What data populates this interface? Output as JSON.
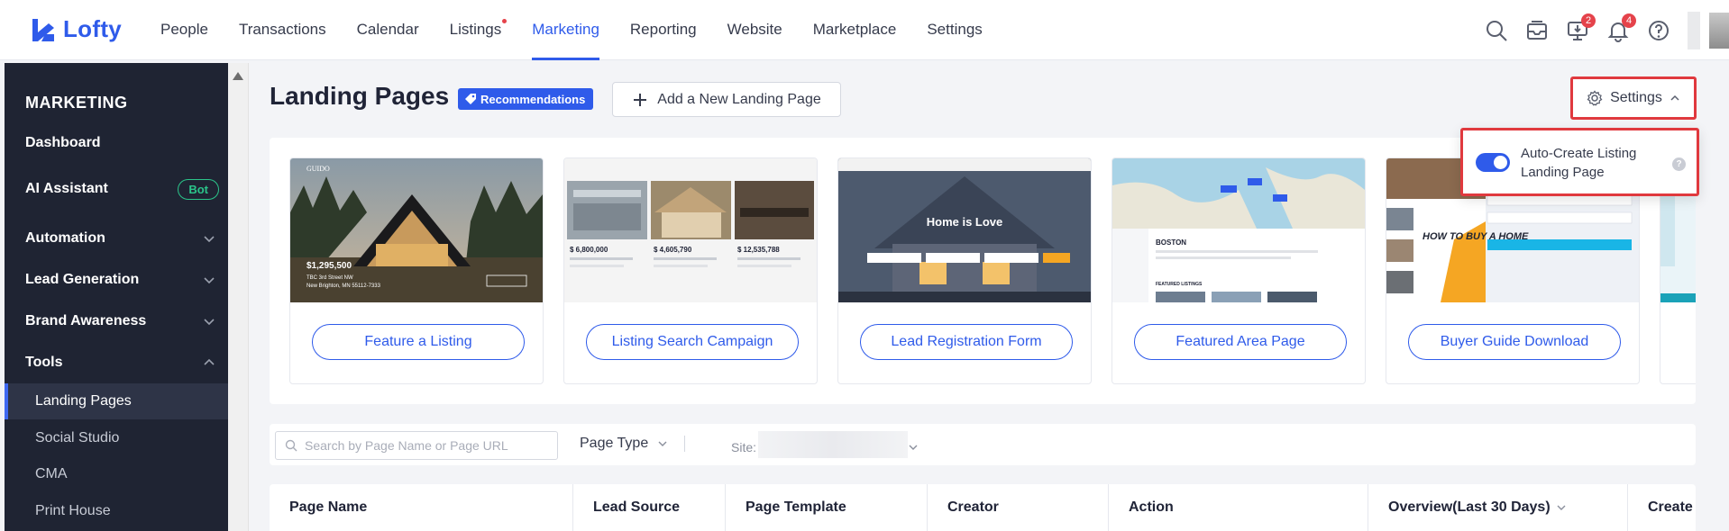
{
  "app": {
    "name": "Lofty",
    "brand_color": "#2f5bea"
  },
  "topnav": {
    "items": [
      {
        "label": "People",
        "active": false
      },
      {
        "label": "Transactions",
        "active": false
      },
      {
        "label": "Calendar",
        "active": false
      },
      {
        "label": "Listings",
        "active": false,
        "dot": true
      },
      {
        "label": "Marketing",
        "active": true
      },
      {
        "label": "Reporting",
        "active": false
      },
      {
        "label": "Website",
        "active": false
      },
      {
        "label": "Marketplace",
        "active": false
      },
      {
        "label": "Settings",
        "active": false
      }
    ],
    "icons": [
      "search-icon",
      "inbox-icon",
      "monitor-icon",
      "bell-icon",
      "help-icon"
    ],
    "monitor_badge": "2",
    "bell_badge": "4"
  },
  "sidebar": {
    "title": "MARKETING",
    "items": [
      {
        "label": "Dashboard"
      },
      {
        "label": "AI Assistant",
        "badge": "Bot"
      },
      {
        "label": "Automation",
        "expanded": false
      },
      {
        "label": "Lead Generation",
        "expanded": false
      },
      {
        "label": "Brand Awareness",
        "expanded": false
      },
      {
        "label": "Tools",
        "expanded": true
      }
    ],
    "sub_items": [
      {
        "label": "Landing Pages",
        "active": true
      },
      {
        "label": "Social Studio",
        "active": false
      },
      {
        "label": "CMA",
        "active": false
      },
      {
        "label": "Print House",
        "active": false
      }
    ]
  },
  "header": {
    "title": "Landing Pages",
    "recommendations_label": "Recommendations",
    "add_label": "Add a New Landing Page",
    "settings_label": "Settings"
  },
  "settings_menu": {
    "toggle_label": "Auto-Create Listing Landing Page",
    "toggle_on": true,
    "help_glyph": "?"
  },
  "templates": [
    {
      "button": "Feature a Listing",
      "price": "$1,295,500",
      "address1": "TBC 3rd Street NW",
      "address2": "New Brighton, MN 55112-7333",
      "brand": "GUIDO"
    },
    {
      "button": "Listing Search Campaign",
      "prices": [
        "$ 6,800,000",
        "$ 4,605,790",
        "$ 12,535,788"
      ]
    },
    {
      "button": "Lead Registration Form",
      "headline": "Home is Love"
    },
    {
      "button": "Featured Area Page",
      "city": "BOSTON",
      "section": "FEATURED LISTINGS"
    },
    {
      "button": "Buyer Guide Download",
      "headline": "HOW TO BUY A HOME"
    }
  ],
  "filters": {
    "search_placeholder": "Search by Page Name or Page URL",
    "page_type_label": "Page Type",
    "site_label": "Site:"
  },
  "table": {
    "columns": [
      "Page Name",
      "Lead Source",
      "Page Template",
      "Creator",
      "Action",
      "Overview(Last 30 Days)",
      "Create"
    ]
  }
}
